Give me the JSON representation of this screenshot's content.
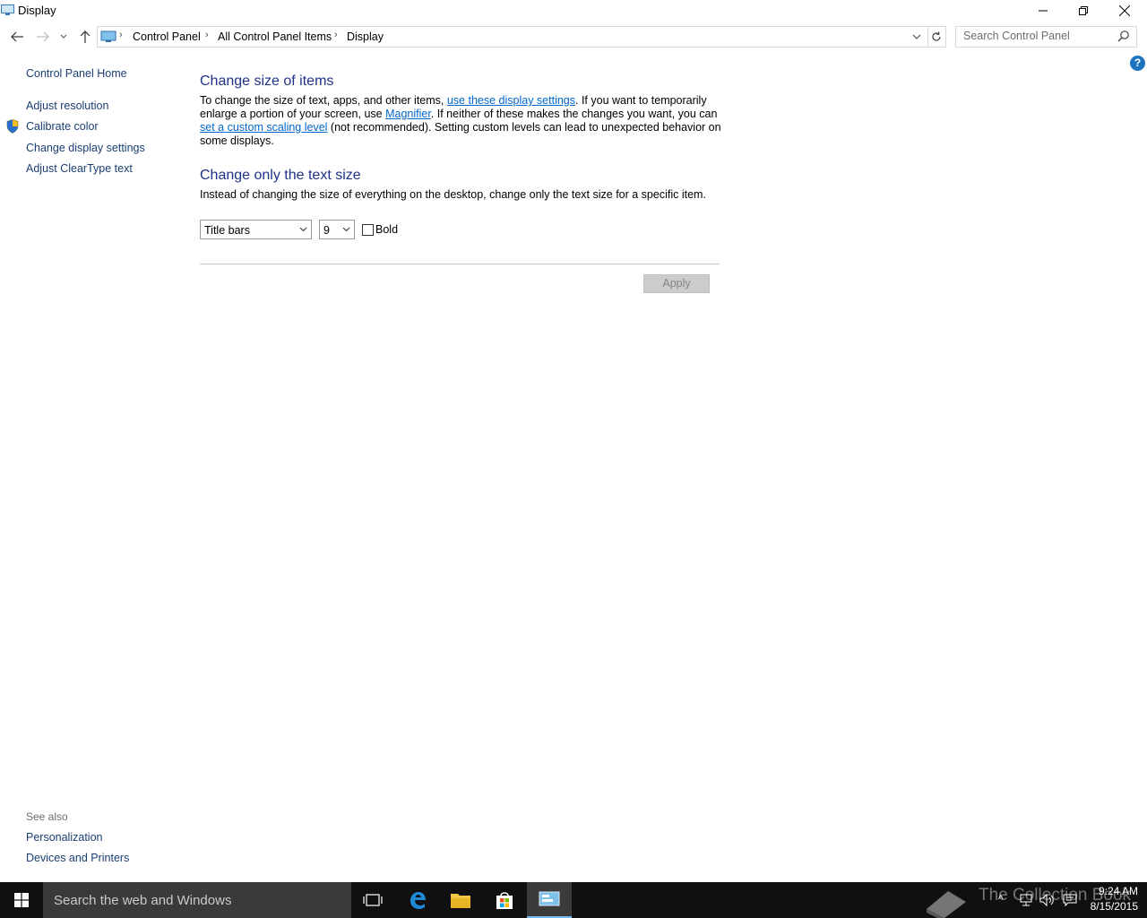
{
  "window": {
    "title": "Display",
    "controls": {
      "minimize": "minimize-icon",
      "maximize": "restore-icon",
      "close": "close-icon"
    }
  },
  "nav": {
    "breadcrumb": [
      "Control Panel",
      "All Control Panel Items",
      "Display"
    ],
    "search_placeholder": "Search Control Panel"
  },
  "sidebar": {
    "home": "Control Panel Home",
    "links": [
      "Adjust resolution",
      "Calibrate color",
      "Change display settings",
      "Adjust ClearType text"
    ],
    "see_also_label": "See also",
    "see_also": [
      "Personalization",
      "Devices and Printers"
    ]
  },
  "main": {
    "section1": {
      "heading": "Change size of items",
      "text_a": "To change the size of text, apps, and other items, ",
      "link_a": "use these display settings",
      "text_b": ".  If you want to temporarily enlarge a portion of your screen, use ",
      "link_b": "Magnifier",
      "text_c": ".  If neither of these makes the changes you want, you can ",
      "link_c": "set a custom scaling level",
      "text_d": " (not recommended).  Setting custom levels can lead to unexpected behavior on some displays."
    },
    "section2": {
      "heading": "Change only the text size",
      "description": "Instead of changing the size of everything on the desktop, change only the text size for a specific item.",
      "item_select": "Title bars",
      "size_select": "9",
      "bold_label": "Bold",
      "bold_checked": false
    },
    "apply_label": "Apply"
  },
  "taskbar": {
    "search_text": "Search the web and Windows",
    "time": "9:24 AM",
    "date": "8/15/2015",
    "watermark": "The Collection Book",
    "accent": "#76b9ed"
  },
  "colors": {
    "link": "#0066cc",
    "heading": "#1e3287",
    "sidebar_link": "#1a3e72",
    "taskbar": "#101010"
  }
}
